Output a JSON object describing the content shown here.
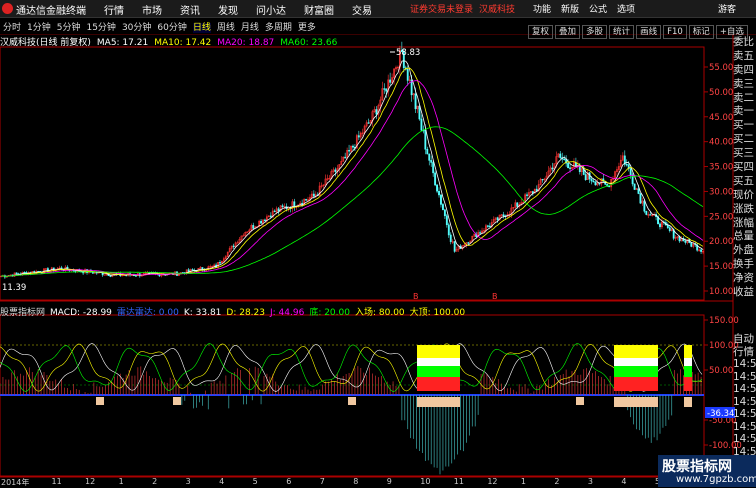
{
  "app_title": "通达信金融终端",
  "menu": [
    "行情",
    "市场",
    "资讯",
    "发现",
    "问小达",
    "财富圈",
    "交易"
  ],
  "notice": "证券交易未登录",
  "stock_name_top": "汉威科技",
  "right_menu": [
    "功能",
    "新版",
    "公式",
    "选项"
  ],
  "guest": "游客",
  "periods": [
    "分时",
    "1分钟",
    "5分钟",
    "15分钟",
    "30分钟",
    "60分钟",
    "日线",
    "周线",
    "月线",
    "多周期",
    "更多"
  ],
  "active_period": "日线",
  "tools": [
    "复权",
    "叠加",
    "多股",
    "统计",
    "画线",
    "F10",
    "标记",
    "+自选"
  ],
  "main_header": {
    "title": "汉威科技(日线 前复权)",
    "ma5": "MA5: 17.21",
    "ma10": "MA10: 17.42",
    "ma20": "MA20: 18.87",
    "ma60": "MA60: 23.66"
  },
  "price_axis": [
    "55.00",
    "50.00",
    "45.00",
    "40.00",
    "35.00",
    "30.00",
    "25.00",
    "20.00",
    "15.00",
    "10.00"
  ],
  "high_label": "58.83",
  "low_label": "11.39",
  "sub_header": {
    "name": "股票指标网",
    "macd": "MACD: -28.99",
    "radar": "雷达雷达: 0.00",
    "k": "K: 33.81",
    "d": "D: 28.23",
    "j": "J: 44.96",
    "di": "底: 20.00",
    "ruchang": "入场: 80.00",
    "dading": "大顶: 100.00"
  },
  "sub_axis": [
    "150.00",
    "100.00",
    "50.00",
    "-50.00",
    "-100.00",
    "-150.00"
  ],
  "sub_value_tag": "-36.34",
  "quote_labels": [
    "委比",
    "卖五",
    "卖四",
    "卖三",
    "卖二",
    "卖一",
    "买一",
    "买二",
    "买三",
    "买四",
    "买五",
    "现价",
    "涨跌",
    "涨幅",
    "总量",
    "外盘",
    "换手",
    "净资",
    "收益"
  ],
  "quote_labels_lower": [
    "自动",
    "行情",
    "14:50",
    "14:50",
    "14:50",
    "14:50",
    "14:50",
    "14:50",
    "14:50",
    "14:50",
    "14:50",
    "14:50"
  ],
  "time_axis": [
    "2014年",
    "11",
    "12",
    "1",
    "2",
    "3",
    "4",
    "5",
    "6",
    "7",
    "8",
    "9",
    "10",
    "11",
    "12",
    "1",
    "2",
    "3",
    "4",
    "5",
    "6"
  ],
  "markers": [
    "B",
    "B"
  ],
  "watermark": {
    "title": "股票指标网",
    "url": "www.7gpzb.com"
  },
  "colors": {
    "up": "#ff3333",
    "down": "#54ffff",
    "ma5": "#ffffff",
    "ma10": "#ffff00",
    "ma20": "#ff00ff",
    "ma60": "#00ff00",
    "axis": "#aa0000",
    "active": "#ffff00"
  }
}
